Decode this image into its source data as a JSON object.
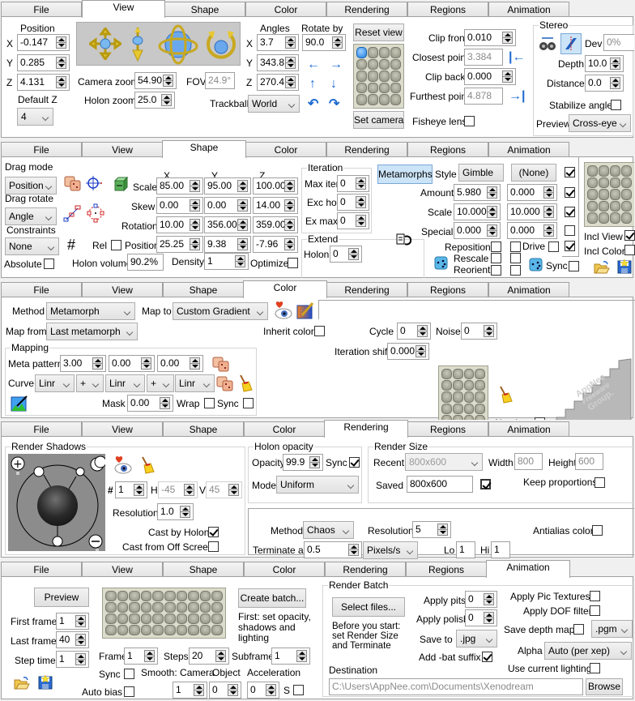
{
  "tabs": [
    "File",
    "View",
    "Shape",
    "Color",
    "Rendering",
    "Regions",
    "Animation"
  ],
  "view": {
    "active_tab": "View",
    "position": {
      "title": "Position",
      "x": "-0.147",
      "y": "0.285",
      "z": "4.131",
      "default_z_label": "Default Z",
      "default_z": "4"
    },
    "camera_zoom_label": "Camera zoom",
    "camera_zoom": "54.90",
    "fov_label": "FOV",
    "fov": "24.9°",
    "holon_zoom_label": "Holon zoom",
    "holon_zoom": "25.0",
    "angles": {
      "title": "Angles",
      "x": "3.7",
      "y": "343.8",
      "z": "270.4"
    },
    "rotate_by_label": "Rotate by",
    "rotate_by": "90.0",
    "trackball_label": "Trackball",
    "trackball": "World",
    "reset_view": "Reset view",
    "set_camera": "Set camera",
    "clip_front_label": "Clip front",
    "clip_front": "0.010",
    "closest_point_label": "Closest point",
    "closest_point": "3.384",
    "clip_back_label": "Clip back",
    "clip_back": "0.000",
    "furthest_point_label": "Furthest point",
    "furthest_point": "4.878",
    "fisheye_label": "Fisheye lens",
    "stereo": {
      "title": "Stereo",
      "dev_label": "Dev",
      "dev": "0%",
      "depth_label": "Depth",
      "depth": "10.0",
      "distance_label": "Distance",
      "distance": "0.0",
      "stabilize_label": "Stabilize angle",
      "preview_label": "Preview",
      "preview": "Cross-eye"
    },
    "axis_labels": [
      "X",
      "Y",
      "Z"
    ]
  },
  "shape": {
    "active_tab": "Shape",
    "drag_mode_label": "Drag mode",
    "drag_mode": "Position",
    "drag_rotate_label": "Drag rotate",
    "drag_rotate": "Angle",
    "constraints_label": "Constraints",
    "constraints": "None",
    "absolute_label": "Absolute",
    "col_headers": [
      "X",
      "Y",
      "Z"
    ],
    "rows": [
      {
        "label": "Scale",
        "values": [
          "85.00",
          "95.00",
          "100.00"
        ]
      },
      {
        "label": "Skew",
        "values": [
          "0.00",
          "0.00",
          "14.00"
        ]
      },
      {
        "label": "Rotation",
        "values": [
          "10.00",
          "356.00",
          "359.00"
        ]
      },
      {
        "label": "Position",
        "values": [
          "25.25",
          "9.38",
          "-7.96"
        ]
      }
    ],
    "rel_label": "Rel",
    "holon_volume_label": "Holon volume",
    "holon_volume": "90.2%",
    "density_label": "Density",
    "density": "1",
    "optimize_label": "Optimize",
    "iteration": {
      "title": "Iteration",
      "max_iter_label": "Max iter",
      "max_iter": "0",
      "exc_hol_label": "Exc hol",
      "exc_hol": "0",
      "ex_max_label": "Ex max",
      "ex_max": "0"
    },
    "extend": {
      "title": "Extend",
      "holon_label": "Holon",
      "holon": "0"
    },
    "metamorphs_button": "Metamorphs",
    "style_label": "Style",
    "style1": "Gimble",
    "style2": "(None)",
    "meta_rows": [
      {
        "label": "Amount",
        "v1": "5.980",
        "v2": "0.000"
      },
      {
        "label": "Scale",
        "v1": "10.000",
        "v2": "10.000"
      },
      {
        "label": "Special",
        "v1": "0.000",
        "v2": "0.000"
      }
    ],
    "reposition_label": "Reposition",
    "rescale_label": "Rescale",
    "reorient_label": "Reorient",
    "drive_label": "Drive",
    "sync_label": "Sync",
    "incl_view_label": "Incl View",
    "incl_color_label": "Incl Color"
  },
  "color": {
    "active_tab": "Color",
    "method_label": "Method",
    "method": "Metamorph",
    "map_to_label": "Map to",
    "map_to": "Custom Gradient",
    "map_from_label": "Map from",
    "map_from": "Last metamorph",
    "inherit_color_label": "Inherit color",
    "cycle_label": "Cycle",
    "cycle": "0",
    "noise_label": "Noise",
    "noise": "0",
    "iteration_shift_label": "Iteration shift",
    "iteration_shift": "0.000",
    "mapping": {
      "title": "Mapping",
      "meta_pattern_label": "Meta pattern",
      "meta_pattern": [
        "3.00",
        "0.00",
        "0.00"
      ],
      "curve_label": "Curve",
      "curves": [
        "Linr",
        "+",
        "Linr",
        "+",
        "Linr"
      ],
      "mask_label": "Mask",
      "mask": "0.00",
      "wrap_label": "Wrap",
      "sync_label": "Sync"
    },
    "absolute_label": "Absolute",
    "watermark": [
      "AppNee",
      "Freeware",
      "Group."
    ]
  },
  "rendering": {
    "active_tab": "Rendering",
    "render_shadows": {
      "title": "Render Shadows",
      "num_label": "#",
      "num": "1",
      "h_label": "H",
      "h": "-45",
      "v_label": "V",
      "v": "45",
      "resolution_label": "Resolution",
      "resolution": "1.0",
      "cast_by_holon_label": "Cast by Holon",
      "cast_off_screen_label": "Cast from Off Screen"
    },
    "holon_opacity": {
      "title": "Holon opacity",
      "opacity_label": "Opacity",
      "opacity": "99.9",
      "sync_label": "Sync",
      "mode_label": "Mode",
      "mode": "Uniform"
    },
    "render_size": {
      "title": "Render Size",
      "recent_label": "Recent",
      "recent": "800x600",
      "width_label": "Width",
      "width": "800",
      "height_label": "Height",
      "height": "600",
      "saved_label": "Saved",
      "saved": "800x600",
      "keep_label": "Keep proportions"
    },
    "method_label": "Method",
    "method": "Chaos",
    "resolution_label": "Resolution",
    "resolution": "5",
    "antialias_label": "Antialias color",
    "terminate_label": "Terminate at",
    "terminate": "0.5",
    "terminate_unit": "Pixels/s",
    "lo_label": "Lo",
    "lo": "1",
    "hi_label": "Hi",
    "hi": "1"
  },
  "animation": {
    "active_tab": "Animation",
    "preview_button": "Preview",
    "first_frame_label": "First frame",
    "first_frame": "1",
    "last_frame_label": "Last frame",
    "last_frame": "40",
    "step_time_label": "Step time",
    "step_time": "1",
    "create_batch_button": "Create batch...",
    "batch_note": "First: set opacity, shadows and lighting",
    "frame_label": "Frame",
    "frame": "1",
    "steps_label": "Steps",
    "steps": "20",
    "subframe_label": "Subframe",
    "subframe": "1",
    "sync_label": "Sync",
    "smooth_label": "Smooth: Camera",
    "object_label": "Object",
    "acceleration_label": "Acceleration",
    "auto_bias_label": "Auto bias",
    "camera": "1",
    "object": "0",
    "acceleration": "0",
    "s_label": "S",
    "render_batch": {
      "title": "Render Batch",
      "select_files_button": "Select files...",
      "note": "Before you start: set Render Size and Terminate",
      "apply_pits_label": "Apply pits",
      "apply_pits": "0",
      "apply_polish_label": "Apply polish",
      "apply_polish": "0",
      "save_to_label": "Save to",
      "save_to": ".jpg",
      "add_bat_label": "Add -bat suffix",
      "apply_pic_label": "Apply Pic Textures",
      "apply_dof_label": "Apply DOF filter",
      "save_depth_label": "Save depth map",
      "depth_format": ".pgm",
      "alpha_label": "Alpha",
      "alpha": "Auto (per xep)",
      "use_lighting_label": "Use current lighting",
      "destination_label": "Destination",
      "destination": "C:\\Users\\AppNee.com\\Documents\\Xenodream",
      "browse_button": "Browse"
    }
  }
}
